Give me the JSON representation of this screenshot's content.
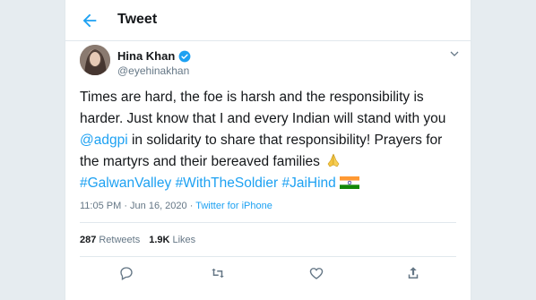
{
  "header": {
    "title": "Tweet"
  },
  "user": {
    "name": "Hina Khan",
    "handle": "@eyehinakhan"
  },
  "tweet": {
    "line_part1": "Times are hard, the foe is harsh and the responsibility is harder. Just know that I and every Indian will stand with you ",
    "mention": "@adgpi",
    "line_part2": " in solidarity to share that responsibility! Prayers for the martyrs and their bereaved families ",
    "hashtag1": "#GalwanValley",
    "hashtag2": "#WithTheSoldier",
    "hashtag3": "#JaiHind"
  },
  "meta": {
    "time": "11:05 PM · Jun 16, 2020 · ",
    "source": "Twitter for iPhone"
  },
  "stats": {
    "retweets_count": "287",
    "retweets_label": "Retweets",
    "likes_count": "1.9K",
    "likes_label": "Likes"
  },
  "colors": {
    "accent": "#1da1f2",
    "text": "#14171a",
    "muted": "#657786",
    "background": "#e6ecf0"
  },
  "icons": [
    "back-arrow-icon",
    "verified-badge-icon",
    "chevron-down-icon",
    "reply-icon",
    "retweet-icon",
    "like-icon",
    "share-icon"
  ]
}
